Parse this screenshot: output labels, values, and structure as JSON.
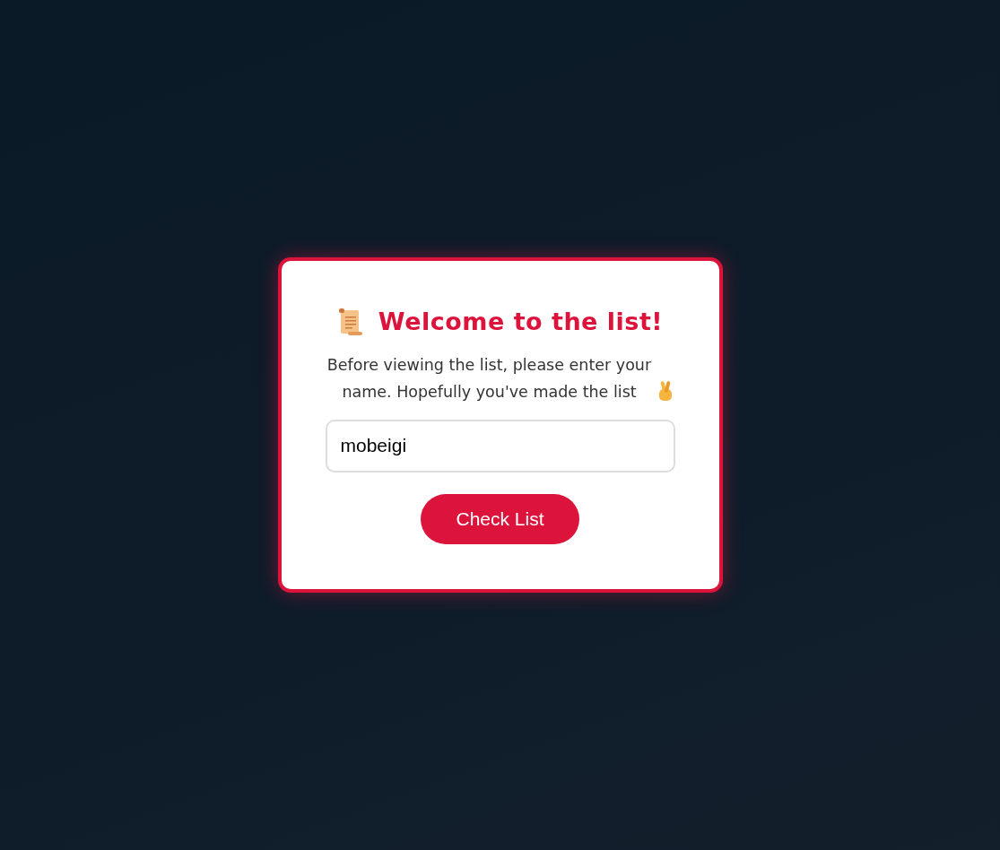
{
  "card": {
    "title": "Welcome to the list!",
    "message": "Before viewing the list, please enter your name. Hopefully you've made the list",
    "name_field": {
      "value": "mobeigi"
    },
    "submit_button": {
      "label": "Check List"
    }
  }
}
